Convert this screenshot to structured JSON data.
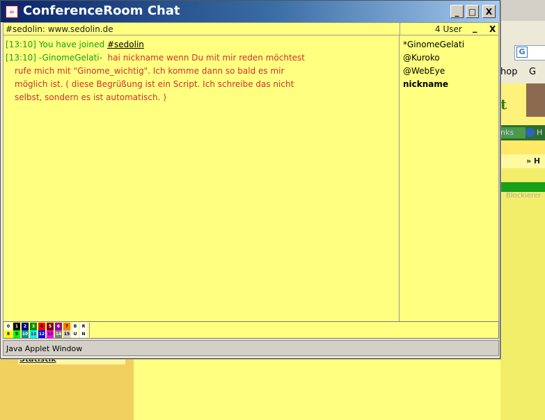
{
  "window": {
    "title": "ConferenceRoom Chat",
    "minimize_label": "_",
    "maximize_label": "□",
    "close_label": "X"
  },
  "channel_bar": {
    "topic": "#sedolin: www.sedolin.de",
    "user_count": "4 User",
    "minimize_label": "_",
    "close_label": "X"
  },
  "messages": [
    {
      "time": "[13:10]",
      "text": "You have joined",
      "channel": "#sedolin"
    },
    {
      "time": "[13:10]",
      "nick": "-GinomeGelati-",
      "line1": "hai nickname wenn Du mit mir reden möchtest",
      "line2": "rufe mich mit \"Ginome_wichtig\". Ich komme dann so bald es mir",
      "line3": "möglich ist. ( diese Begrüßung ist ein Script. Ich schreibe das nicht",
      "line4": "selbst, sondern es ist automatisch. )"
    }
  ],
  "users": [
    {
      "name": "*GinomeGelati"
    },
    {
      "name": "@Kuroko"
    },
    {
      "name": "@WebEye"
    },
    {
      "name": "nickname"
    }
  ],
  "palette": {
    "row1": [
      "0",
      "1",
      "2",
      "3",
      "4",
      "5",
      "6",
      "7",
      "B",
      "R"
    ],
    "row2": [
      "8",
      "9",
      "10",
      "11",
      "12",
      "13",
      "14",
      "15",
      "U",
      "N"
    ],
    "colors_row1": [
      "#ffffff",
      "#000000",
      "#00007f",
      "#009300",
      "#ff0000",
      "#7f0000",
      "#9c009c",
      "#fc7f00",
      "#ffffff",
      "#ffffff"
    ],
    "colors_row2": [
      "#ffff00",
      "#00fc00",
      "#009393",
      "#00ffff",
      "#0000fc",
      "#ff00ff",
      "#7f7f7f",
      "#d2d2d2",
      "#ffffff",
      "#ffffff"
    ]
  },
  "status": {
    "text": "Java Applet Window"
  },
  "background_page": {
    "shop_label": "hop",
    "shop_label2": "G",
    "header_letter": "t",
    "nav_item": "nks",
    "nav_h": "H",
    "bar2_text": "» H",
    "block_text": "Blockierer",
    "stat_link": "Statistik"
  },
  "colors": {
    "chat_background": "#ffff80",
    "timestamp_green": "#18a018",
    "message_red": "#d03030",
    "title_gradient_start": "#0a246a"
  }
}
